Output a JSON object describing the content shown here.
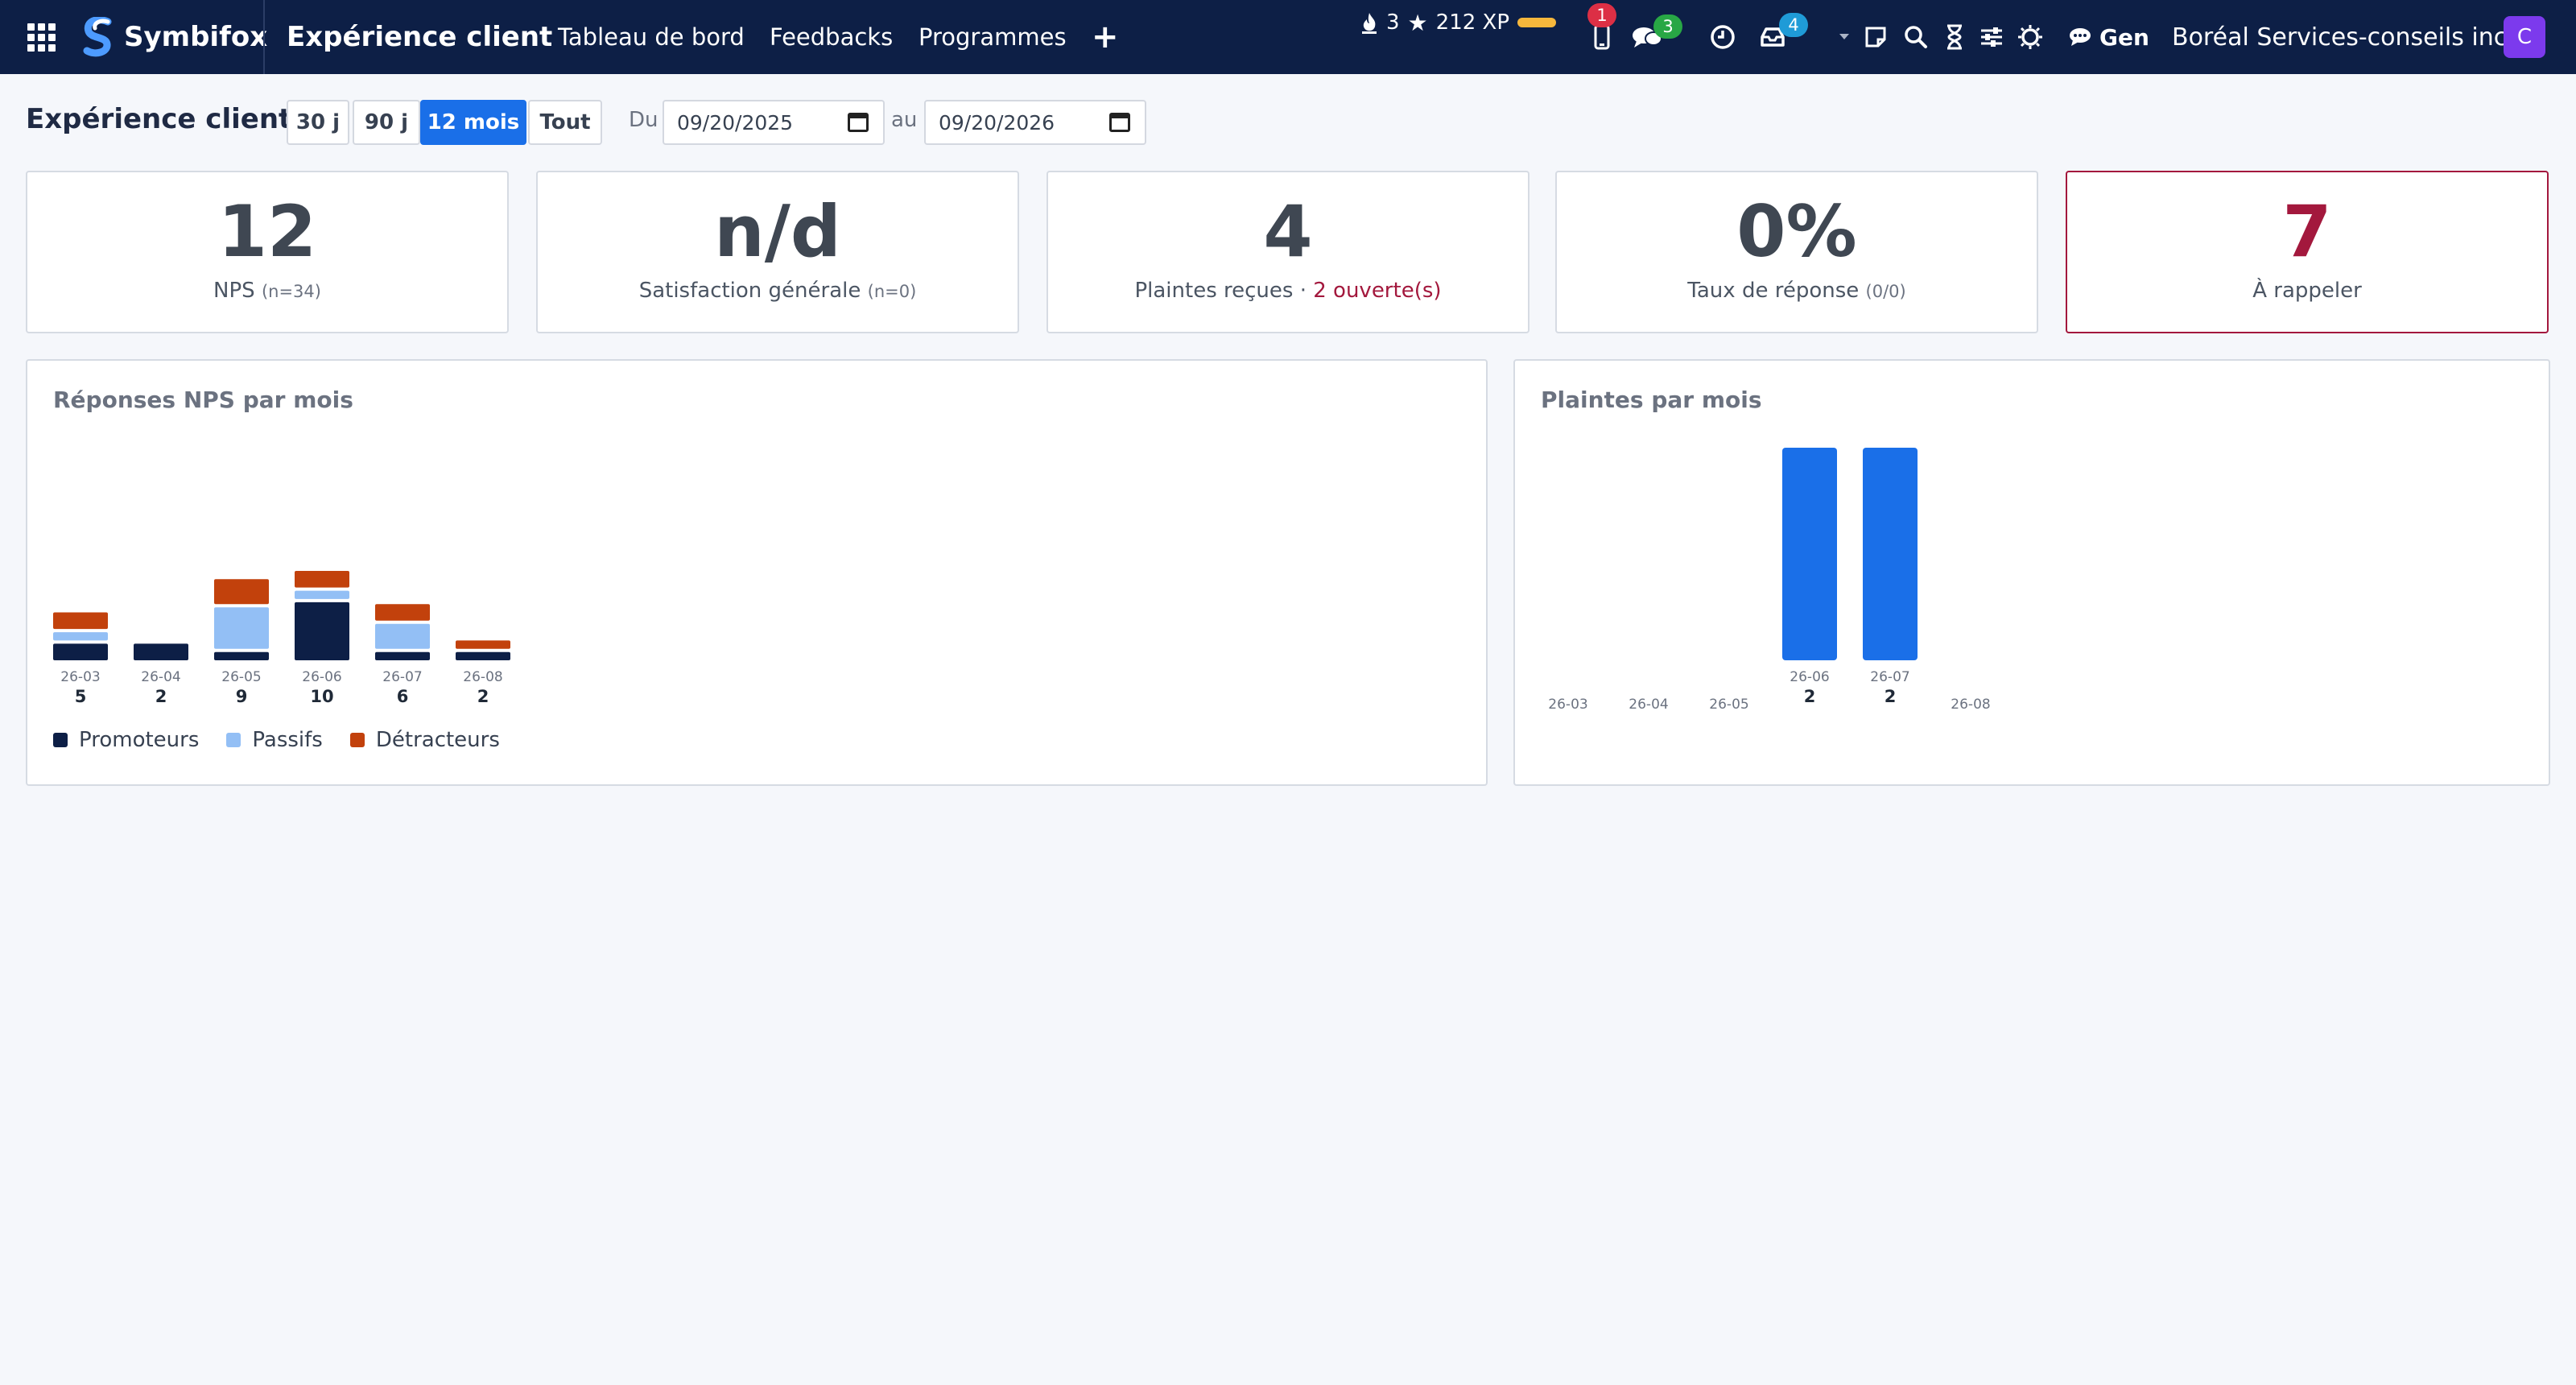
{
  "nav": {
    "brand": "Symbifox",
    "app_title": "Expérience client",
    "menu": [
      "Tableau de bord",
      "Feedbacks",
      "Programmes"
    ],
    "add_symbol": "+",
    "streak": "3",
    "xp": "212 XP",
    "xp_bar_color": "#f6b73c",
    "badges": {
      "mobile": "1",
      "chat": "3",
      "inbox": "4"
    },
    "gen_label": "Gen",
    "company": "Boréal Services-conseils inc.",
    "avatar_initial": "C",
    "colors": {
      "bar_bg": "#0d1f46",
      "avatar": "#7c3aed",
      "badge_red": "#dc2f45",
      "badge_green": "#28a745",
      "badge_blue": "#1f9bd7"
    }
  },
  "filters": {
    "title": "Expérience client",
    "ranges": [
      "30 j",
      "90 j",
      "12 mois",
      "Tout"
    ],
    "active_range": "12 mois",
    "from_label": "Du",
    "from_date": "09/20/2025",
    "to_label": "au",
    "to_date": "09/20/2026"
  },
  "kpis": [
    {
      "value": "12",
      "label": "NPS",
      "sub": "(n=34)"
    },
    {
      "value": "n/d",
      "label": "Satisfaction générale",
      "sub": "(n=0)"
    },
    {
      "value": "4",
      "label": "Plaintes reçues",
      "separator": "·",
      "open": "2 ouverte(s)"
    },
    {
      "value": "0%",
      "label": "Taux de réponse",
      "sub": "(0/0)"
    },
    {
      "value": "7",
      "label": "À rappeler",
      "alert": true
    }
  ],
  "nps_chart": {
    "title": "Réponses NPS par mois",
    "legend": [
      "Promoteurs",
      "Passifs",
      "Détracteurs"
    ]
  },
  "complaints_chart": {
    "title": "Plaintes par mois"
  },
  "chart_data": [
    {
      "type": "bar",
      "stacked": true,
      "title": "Réponses NPS par mois",
      "categories": [
        "26-03",
        "26-04",
        "26-05",
        "26-06",
        "26-07",
        "26-08"
      ],
      "totals": [
        5,
        2,
        9,
        10,
        6,
        2
      ],
      "series": [
        {
          "name": "Promoteurs",
          "color": "#0d1f46",
          "values": [
            2,
            2,
            1,
            7,
            1,
            1
          ]
        },
        {
          "name": "Passifs",
          "color": "#93bff5",
          "values": [
            1,
            0,
            5,
            1,
            3,
            0
          ]
        },
        {
          "name": "Détracteurs",
          "color": "#c2410c",
          "values": [
            2,
            0,
            3,
            2,
            2,
            1
          ]
        }
      ]
    },
    {
      "type": "bar",
      "title": "Plaintes par mois",
      "categories": [
        "26-03",
        "26-04",
        "26-05",
        "26-06",
        "26-07",
        "26-08"
      ],
      "values": [
        0,
        0,
        0,
        2,
        2,
        0
      ],
      "color": "#1a6fe8"
    }
  ]
}
